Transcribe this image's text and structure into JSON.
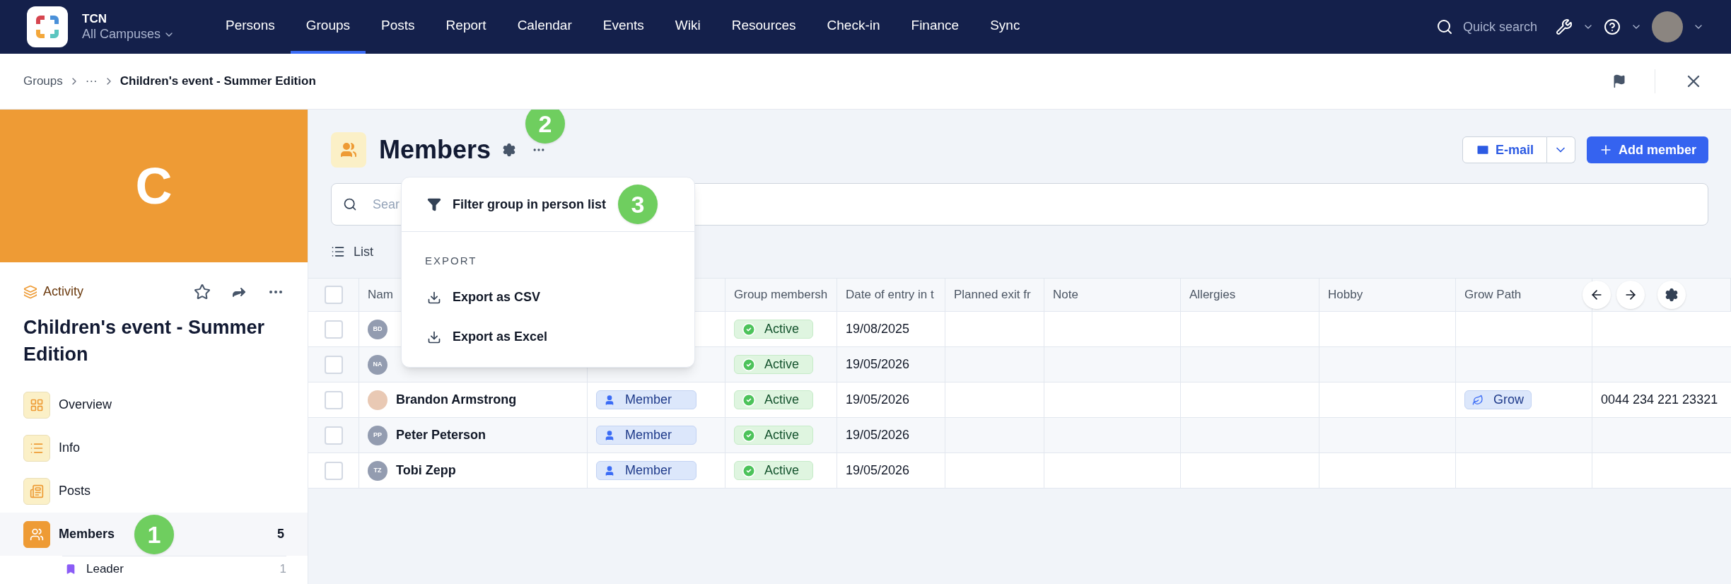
{
  "app": {
    "name": "TCN",
    "campus": "All Campuses"
  },
  "nav": [
    {
      "label": "Persons",
      "selected": false
    },
    {
      "label": "Groups",
      "selected": true
    },
    {
      "label": "Posts",
      "selected": false
    },
    {
      "label": "Report",
      "selected": false
    },
    {
      "label": "Calendar",
      "selected": false
    },
    {
      "label": "Events",
      "selected": false
    },
    {
      "label": "Wiki",
      "selected": false
    },
    {
      "label": "Resources",
      "selected": false
    },
    {
      "label": "Check-in",
      "selected": false
    },
    {
      "label": "Finance",
      "selected": false
    },
    {
      "label": "Sync",
      "selected": false
    }
  ],
  "quick_search": {
    "placeholder": "Quick search"
  },
  "breadcrumb": [
    "Groups",
    "···",
    "Children's event - Summer Edition"
  ],
  "sidebar": {
    "cover_letter": "C",
    "category": "Activity",
    "title": "Children's event - Summer Edition",
    "items": [
      {
        "label": "Overview",
        "kind": "grid",
        "selected": false
      },
      {
        "label": "Info",
        "kind": "list",
        "selected": false
      },
      {
        "label": "Posts",
        "kind": "news",
        "selected": false
      },
      {
        "label": "Members",
        "kind": "people",
        "selected": true,
        "count": "5",
        "children": [
          {
            "label": "Leader",
            "count": "1"
          }
        ]
      }
    ]
  },
  "page": {
    "title": "Members",
    "email_button": "E-mail",
    "add_button": "Add member",
    "search": {
      "placeholder": "Sear"
    },
    "view": "List"
  },
  "menu": {
    "items": [
      {
        "label": "Filter group in person list",
        "kind": "filter"
      }
    ],
    "section": "EXPORT",
    "export_items": [
      {
        "label": "Export as CSV",
        "kind": "download"
      },
      {
        "label": "Export as Excel",
        "kind": "download"
      }
    ]
  },
  "table": {
    "all_checked": false,
    "columns": [
      "Nam",
      "",
      "Group membersh",
      "Date of entry in t",
      "Planned exit fr",
      "Note",
      "Allergies",
      "Hobby",
      "Grow Path",
      ""
    ],
    "rows": [
      {
        "checked": false,
        "initials": "BD",
        "kind": "initials",
        "status": "Active",
        "date": "19/08/2025"
      },
      {
        "checked": false,
        "initials": "NA",
        "kind": "initials",
        "status": "Active",
        "date": "19/05/2026"
      },
      {
        "checked": false,
        "kind": "photo",
        "name": "Brandon Armstrong",
        "role": "Member",
        "status": "Active",
        "date": "19/05/2026",
        "grow_path": "Grow",
        "phone": "0044 234 221 23321"
      },
      {
        "checked": false,
        "initials": "PP",
        "kind": "initials",
        "name": "Peter Peterson",
        "role": "Member",
        "status": "Active",
        "date": "19/05/2026"
      },
      {
        "checked": false,
        "initials": "TZ",
        "kind": "initials",
        "name": "Tobi Zepp",
        "role": "Member",
        "status": "Active",
        "date": "19/05/2026"
      }
    ]
  },
  "annotations": [
    "1",
    "2",
    "3"
  ]
}
